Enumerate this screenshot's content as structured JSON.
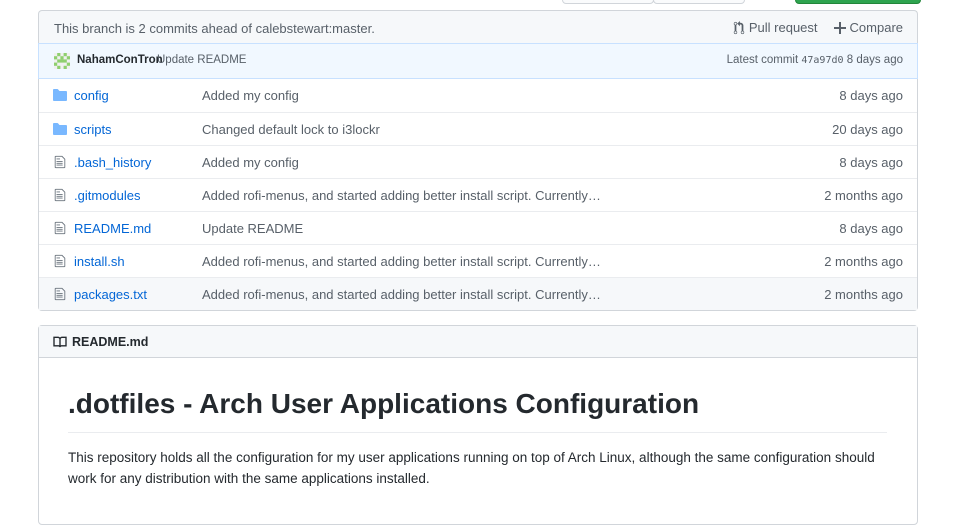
{
  "branch_bar": {
    "message": "This branch is 2 commits ahead of calebstewart:master.",
    "pull_request_label": "Pull request",
    "compare_label": "Compare"
  },
  "latest_commit": {
    "author": "NahamConTron",
    "message": "Update README",
    "prefix": "Latest commit",
    "sha": "47a97d0",
    "age": "8 days ago"
  },
  "files": [
    {
      "name": "config",
      "type": "folder",
      "message": "Added my config",
      "age": "8 days ago"
    },
    {
      "name": "scripts",
      "type": "folder",
      "message": "Changed default lock to i3lockr",
      "age": "20 days ago"
    },
    {
      "name": ".bash_history",
      "type": "file",
      "message": "Added my config",
      "age": "8 days ago"
    },
    {
      "name": ".gitmodules",
      "type": "file",
      "message": "Added rofi-menus, and started adding better install script. Currently…",
      "age": "2 months ago"
    },
    {
      "name": "README.md",
      "type": "file",
      "message": "Update README",
      "age": "8 days ago"
    },
    {
      "name": "install.sh",
      "type": "file",
      "message": "Added rofi-menus, and started adding better install script. Currently…",
      "age": "2 months ago"
    },
    {
      "name": "packages.txt",
      "type": "file",
      "message": "Added rofi-menus, and started adding better install script. Currently…",
      "age": "2 months ago"
    }
  ],
  "readme": {
    "filename": "README.md",
    "title": ".dotfiles - Arch User Applications Configuration",
    "paragraph": "This repository holds all the configuration for my user applications running on top of Arch Linux, although the same configuration should work for any distribution with the same applications installed."
  },
  "colors": {
    "link": "#0366d6",
    "muted": "#586069",
    "folder_icon": "#79b8ff",
    "file_icon": "#6a737d",
    "commit_bar_bg": "#f1f8ff"
  }
}
